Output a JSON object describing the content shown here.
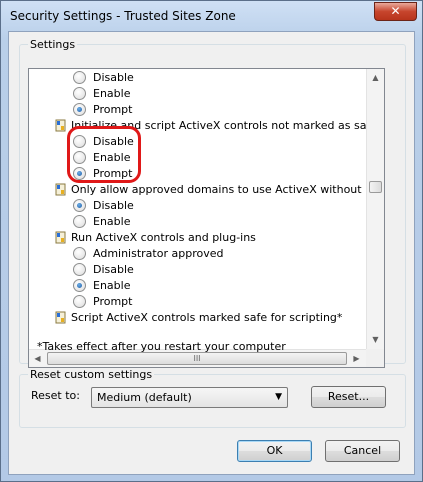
{
  "window": {
    "title": "Security Settings - Trusted Sites Zone",
    "close_glyph": "✕"
  },
  "settings": {
    "group_label": "Settings",
    "items": [
      {
        "type": "radio",
        "label": "Disable",
        "checked": false
      },
      {
        "type": "radio",
        "label": "Enable",
        "checked": false
      },
      {
        "type": "radio",
        "label": "Prompt",
        "checked": true
      },
      {
        "type": "header",
        "label": "Initialize and script ActiveX controls not marked as safe for sc",
        "icon": "settings-shield-icon"
      },
      {
        "type": "radio",
        "label": "Disable",
        "checked": false
      },
      {
        "type": "radio",
        "label": "Enable",
        "checked": false
      },
      {
        "type": "radio",
        "label": "Prompt",
        "checked": true
      },
      {
        "type": "header",
        "label": "Only allow approved domains to use ActiveX without prompt",
        "icon": "settings-shield-icon"
      },
      {
        "type": "radio",
        "label": "Disable",
        "checked": true
      },
      {
        "type": "radio",
        "label": "Enable",
        "checked": false
      },
      {
        "type": "header",
        "label": "Run ActiveX controls and plug-ins",
        "icon": "settings-shield-icon"
      },
      {
        "type": "radio",
        "label": "Administrator approved",
        "checked": false
      },
      {
        "type": "radio",
        "label": "Disable",
        "checked": false
      },
      {
        "type": "radio",
        "label": "Enable",
        "checked": true
      },
      {
        "type": "radio",
        "label": "Prompt",
        "checked": false
      },
      {
        "type": "header",
        "label": "Script ActiveX controls marked safe for scripting*",
        "icon": "settings-shield-icon"
      }
    ],
    "note": "*Takes effect after you restart your computer"
  },
  "scrollbar": {
    "up": "▲",
    "down": "▼",
    "left": "◀",
    "right": "▶",
    "grip": "III"
  },
  "reset": {
    "group_label": "Reset custom settings",
    "reset_to_label": "Reset to:",
    "selected_level": "Medium (default)",
    "dropdown_arrow": "▼",
    "reset_button": "Reset..."
  },
  "footer": {
    "ok": "OK",
    "cancel": "Cancel"
  },
  "colors": {
    "highlight_annotation": "#e01818",
    "radio_dot": "#1c5aa3"
  }
}
